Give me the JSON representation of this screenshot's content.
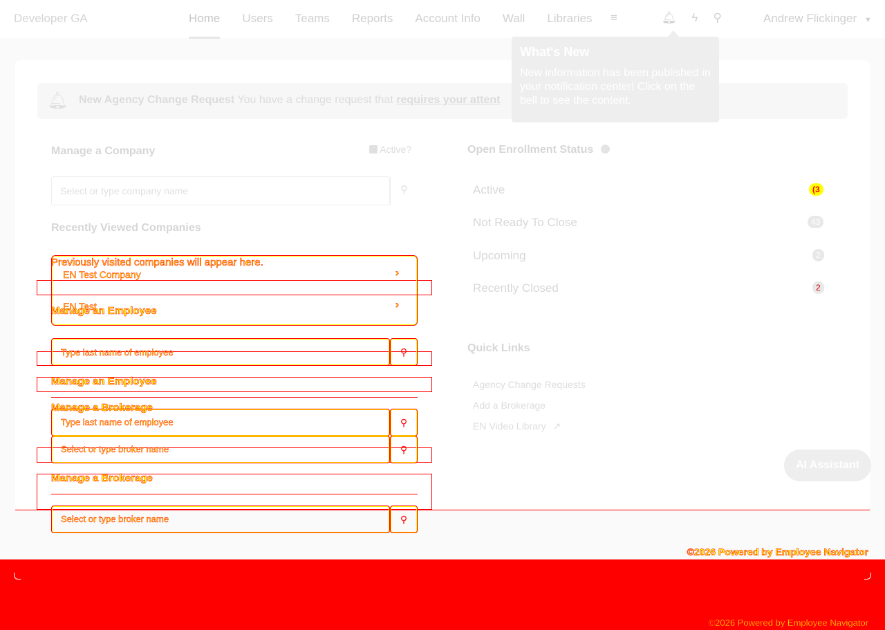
{
  "brand": "Developer GA",
  "nav": {
    "items": [
      "Home",
      "Users",
      "Teams",
      "Reports",
      "Account Info",
      "Wall",
      "Libraries"
    ],
    "menu_icon": "hamburger-icon",
    "bell_icon": "bell-icon",
    "bolt_icon": "lightning-icon",
    "search_icon": "search-icon"
  },
  "user": {
    "name": "Andrew Flickinger"
  },
  "alert": {
    "title": "New Agency Change Request",
    "text": "You have a change request that",
    "link": "requires your attent"
  },
  "popover": {
    "title": "What's New",
    "body": "New information has been published in your notification center! Click on the bell to see the content."
  },
  "manage_company": {
    "title": "Manage a Company",
    "active_label": "Active?",
    "placeholder": "Select or type company name",
    "recent_title": "Recently Viewed Companies",
    "empty_text": "Previously visited companies will appear here.",
    "recent": [
      "EN Test Company",
      "EN Test"
    ]
  },
  "manage_employee": {
    "title": "Manage an Employee",
    "placeholder": "Type last name of employee"
  },
  "manage_brokerage": {
    "title": "Manage a Brokerage",
    "placeholder": "Select or type broker name"
  },
  "open_enrollment": {
    "title": "Open Enrollment Status",
    "rows": [
      {
        "label": "Active",
        "count": "(3"
      },
      {
        "label": "Not Ready To Close",
        "count": "43"
      },
      {
        "label": "Upcoming",
        "count": "2"
      },
      {
        "label": "Recently Closed",
        "count": "2"
      }
    ]
  },
  "quick_links": {
    "title": "Quick Links",
    "links": [
      "Agency Change Requests",
      "Add a Brokerage",
      "EN Video Library"
    ]
  },
  "ai_button": "AI Assistant",
  "footer": "©2026 Powered by Employee Navigator"
}
